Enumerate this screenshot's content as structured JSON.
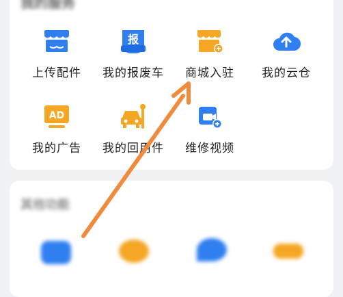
{
  "section1": {
    "title": "我的服务",
    "items": [
      {
        "label": "上传配件",
        "icon": "shop-icon"
      },
      {
        "label": "我的报废车",
        "icon": "scrap-report-icon",
        "badge": "报"
      },
      {
        "label": "商城入驻",
        "icon": "mall-join-icon"
      },
      {
        "label": "我的云仓",
        "icon": "cloud-upload-icon"
      },
      {
        "label": "我的广告",
        "icon": "ad-icon",
        "badge": "AD"
      },
      {
        "label": "我的回用件",
        "icon": "car-repair-icon"
      },
      {
        "label": "维修视频",
        "icon": "video-add-icon"
      }
    ]
  },
  "section2": {
    "title": "其他功能"
  },
  "colors": {
    "blue": "#2f7ff0",
    "orange": "#f5a623",
    "arrow": "#f08a3c"
  }
}
